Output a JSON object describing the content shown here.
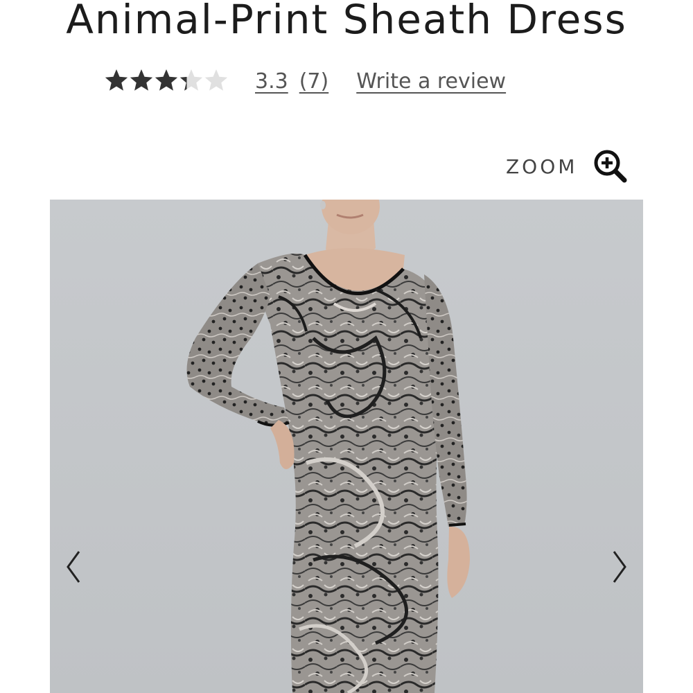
{
  "product": {
    "title": "Animal-Print Sheath Dress"
  },
  "rating": {
    "stars_value": 3.3,
    "stars_max": 5,
    "value_label": "3.3",
    "count_label": "(7)",
    "write_review_label": "Write a review"
  },
  "zoom": {
    "label": "ZOOM",
    "icon": "zoom-in-icon"
  },
  "carousel": {
    "image_alt": "Animal-Print Sheath Dress",
    "prev_icon": "chevron-left-icon",
    "next_icon": "chevron-right-icon"
  },
  "colors": {
    "star_filled": "#333333",
    "star_empty": "#e0e0e0",
    "photo_background": "#c5c8cb",
    "dress_base": "#8d8985"
  }
}
